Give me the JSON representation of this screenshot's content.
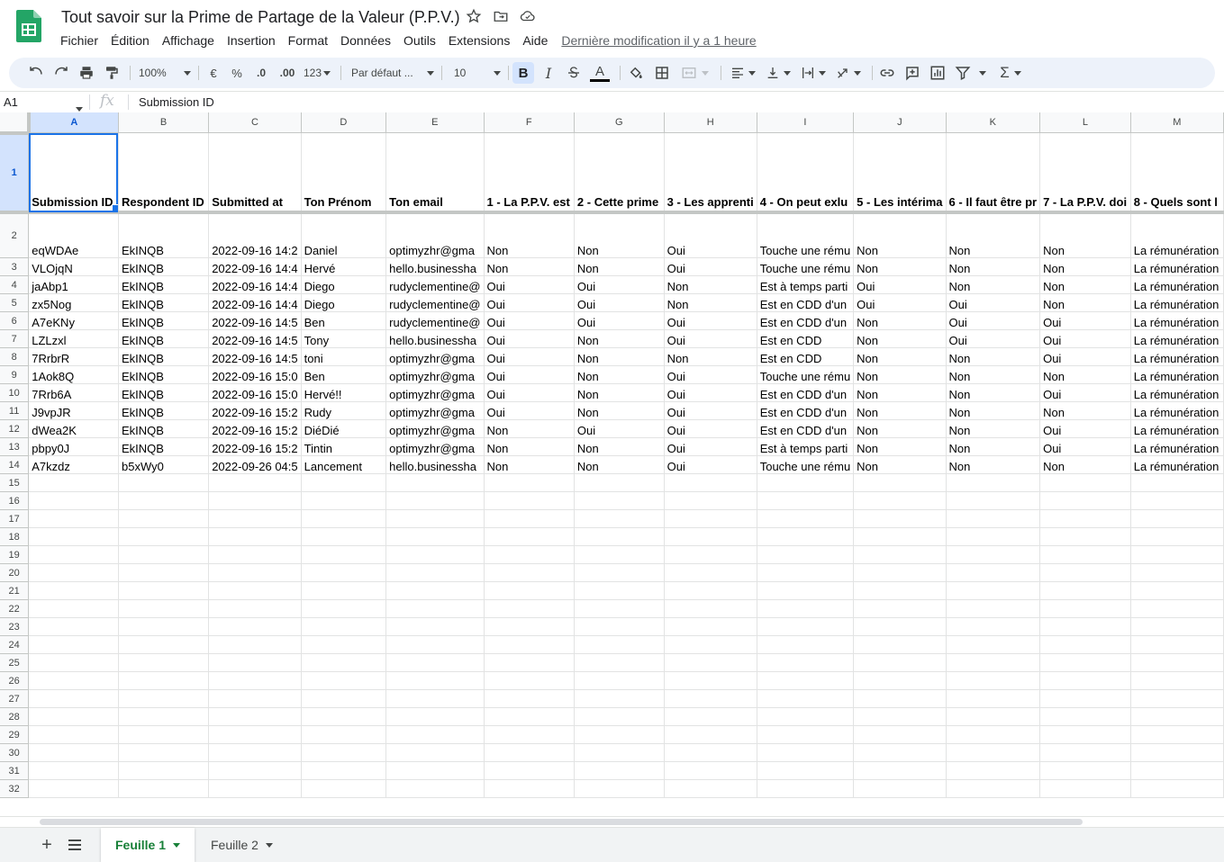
{
  "app": {
    "doc_title": "Tout savoir sur la Prime de Partage de la Valeur (P.P.V.)",
    "last_edit": "Dernière modification il y a 1 heure",
    "icons": [
      "sheets-logo-icon",
      "star-icon",
      "move-folder-icon",
      "cloud-saved-icon"
    ]
  },
  "menu": [
    "Fichier",
    "Édition",
    "Affichage",
    "Insertion",
    "Format",
    "Données",
    "Outils",
    "Extensions",
    "Aide"
  ],
  "toolbar": {
    "zoom": "100%",
    "currency": "€",
    "percent": "%",
    "decrease_decimals": ".0",
    "increase_decimals": ".00",
    "more_formats": "123",
    "font": "Par défaut ...",
    "font_size": "10",
    "bold": "B",
    "italic": "I",
    "text_color": "A",
    "text_color_hex": "#000000"
  },
  "formula_bar": {
    "cell_ref": "A1",
    "fx": "fx",
    "content": "Submission ID"
  },
  "grid": {
    "columns": [
      "A",
      "B",
      "C",
      "D",
      "E",
      "F",
      "G",
      "H",
      "I",
      "J",
      "K",
      "L",
      "M"
    ],
    "selected_column": "A",
    "selected_row": 1,
    "header_row": [
      "Submission ID",
      "Respondent ID",
      "Submitted at",
      "Ton Prénom",
      "Ton email",
      "1 - La P.P.V. est",
      "2 - Cette prime",
      "3 - Les apprenti",
      "4 - On peut exlu",
      "5 - Les intérima",
      "6 - Il faut être pr",
      "7 - La P.P.V. doi",
      "8 - Quels sont l"
    ],
    "rows": [
      {
        "num": "2",
        "cells": [
          "eqWDAe",
          "EkINQB",
          "2022-09-16 14:2",
          "Daniel",
          "optimyzhr@gma",
          "Non",
          "Non",
          "Oui",
          "Touche une rému",
          "Non",
          "Non",
          "Non",
          "La rémunération"
        ]
      },
      {
        "num": "3",
        "cells": [
          "VLOjqN",
          "EkINQB",
          "2022-09-16 14:4",
          "Hervé",
          "hello.businessha",
          "Non",
          "Non",
          "Oui",
          "Touche une rému",
          "Non",
          "Non",
          "Non",
          "La rémunération"
        ]
      },
      {
        "num": "4",
        "cells": [
          "jaAbp1",
          "EkINQB",
          "2022-09-16 14:4",
          "Diego",
          "rudyclementine@",
          "Oui",
          "Oui",
          "Non",
          "Est à temps parti",
          "Oui",
          "Non",
          "Non",
          "La rémunération"
        ]
      },
      {
        "num": "5",
        "cells": [
          "zx5Nog",
          "EkINQB",
          "2022-09-16 14:4",
          "Diego",
          "rudyclementine@",
          "Oui",
          "Oui",
          "Non",
          "Est en CDD d'un",
          "Oui",
          "Oui",
          "Non",
          "La rémunération"
        ]
      },
      {
        "num": "6",
        "cells": [
          "A7eKNy",
          "EkINQB",
          "2022-09-16 14:5",
          "Ben",
          "rudyclementine@",
          "Oui",
          "Oui",
          "Oui",
          "Est en CDD d'un",
          "Non",
          "Oui",
          "Oui",
          "La rémunération"
        ]
      },
      {
        "num": "7",
        "cells": [
          "LZLzxl",
          "EkINQB",
          "2022-09-16 14:5",
          "Tony",
          "hello.businessha",
          "Oui",
          "Non",
          "Oui",
          "Est en CDD",
          "Non",
          "Oui",
          "Oui",
          "La rémunération"
        ]
      },
      {
        "num": "8",
        "cells": [
          "7RrbrR",
          "EkINQB",
          "2022-09-16 14:5",
          "toni",
          "optimyzhr@gma",
          "Oui",
          "Non",
          "Non",
          "Est en CDD",
          "Non",
          "Non",
          "Oui",
          "La rémunération"
        ]
      },
      {
        "num": "9",
        "cells": [
          "1Aok8Q",
          "EkINQB",
          "2022-09-16 15:0",
          "Ben",
          "optimyzhr@gma",
          "Oui",
          "Non",
          "Oui",
          "Touche une rému",
          "Non",
          "Non",
          "Non",
          "La rémunération"
        ]
      },
      {
        "num": "10",
        "cells": [
          "7Rrb6A",
          "EkINQB",
          "2022-09-16 15:0",
          "Hervé!!",
          "optimyzhr@gma",
          "Oui",
          "Non",
          "Oui",
          "Est en CDD d'un",
          "Non",
          "Non",
          "Oui",
          "La rémunération"
        ]
      },
      {
        "num": "11",
        "cells": [
          "J9vpJR",
          "EkINQB",
          "2022-09-16 15:2",
          "Rudy",
          "optimyzhr@gma",
          "Oui",
          "Non",
          "Oui",
          "Est en CDD d'un",
          "Non",
          "Non",
          "Non",
          "La rémunération"
        ]
      },
      {
        "num": "12",
        "cells": [
          "dWea2K",
          "EkINQB",
          "2022-09-16 15:2",
          "DiéDié",
          "optimyzhr@gma",
          "Non",
          "Oui",
          "Oui",
          "Est en CDD d'un",
          "Non",
          "Non",
          "Oui",
          "La rémunération"
        ]
      },
      {
        "num": "13",
        "cells": [
          "pbpy0J",
          "EkINQB",
          "2022-09-16 15:2",
          "Tintin",
          "optimyzhr@gma",
          "Non",
          "Non",
          "Oui",
          "Est à temps parti",
          "Non",
          "Non",
          "Oui",
          "La rémunération"
        ]
      },
      {
        "num": "14",
        "cells": [
          "A7kzdz",
          "b5xWy0",
          "2022-09-26 04:5",
          "Lancement",
          "hello.businessha",
          "Non",
          "Non",
          "Oui",
          "Touche une rému",
          "Non",
          "Non",
          "Non",
          "La rémunération"
        ]
      }
    ],
    "empty_rows": [
      "15",
      "16",
      "17",
      "18",
      "19",
      "20",
      "21",
      "22",
      "23",
      "24",
      "25",
      "26",
      "27",
      "28",
      "29",
      "30",
      "31",
      "32"
    ]
  },
  "sheets": {
    "tabs": [
      "Feuille 1",
      "Feuille 2"
    ],
    "active": "Feuille 1"
  }
}
